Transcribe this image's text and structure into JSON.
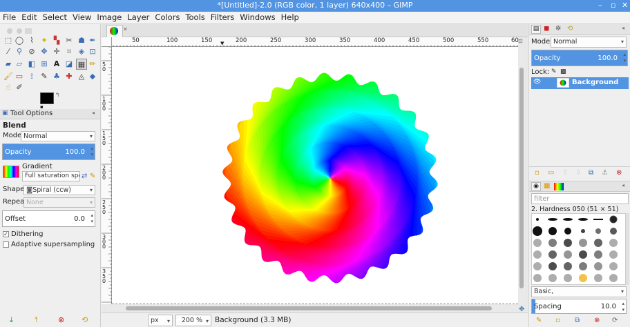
{
  "window": {
    "title": "*[Untitled]-2.0 (RGB color, 1 layer) 640x400 – GIMP",
    "minimize": "–",
    "maximize": "▫",
    "close": "✕"
  },
  "menu": [
    "File",
    "Edit",
    "Select",
    "View",
    "Image",
    "Layer",
    "Colors",
    "Tools",
    "Filters",
    "Windows",
    "Help"
  ],
  "tool_options": {
    "tab_label": "Tool Options",
    "tool_name": "Blend",
    "mode_label": "Mode:",
    "mode_value": "Normal",
    "opacity_label": "Opacity",
    "opacity_value": "100.0",
    "opacity_fraction": 1.0,
    "gradient_label": "Gradient",
    "gradient_value": "Full saturation spect",
    "shape_label": "Shape:",
    "shape_value": "Spiral (ccw)",
    "repeat_label": "Repeat:",
    "repeat_value": "None",
    "offset_label": "Offset",
    "offset_value": "0.0",
    "dithering_label": "Dithering",
    "dithering_checked": true,
    "adaptive_label": "Adaptive supersampling",
    "adaptive_checked": false
  },
  "ruler": {
    "top_labels": [
      "50",
      "100",
      "150",
      "200",
      "250",
      "300",
      "350",
      "400",
      "450",
      "500",
      "550",
      "60"
    ],
    "left_labels": [
      "50",
      "100",
      "150",
      "200",
      "250",
      "300",
      "350"
    ]
  },
  "status": {
    "unit": "px",
    "zoom": "200 %",
    "info": "Background (3.3 MB)"
  },
  "layers": {
    "mode_label": "Mode",
    "mode_value": "Normal",
    "opacity_label": "Opacity",
    "opacity_value": "100.0",
    "opacity_fraction": 1.0,
    "lock_label": "Lock:",
    "layer_name": "Background"
  },
  "brushes": {
    "filter_placeholder": "filter",
    "brush_name": "2. Hardness 050 (51 × 51)",
    "preset_value": "Basic,",
    "spacing_label": "Spacing",
    "spacing_value": "10.0",
    "spacing_fraction": 0.04
  },
  "colors": {
    "accent": "#5294e2",
    "fg": "#000000",
    "bg": "#ffffff"
  }
}
